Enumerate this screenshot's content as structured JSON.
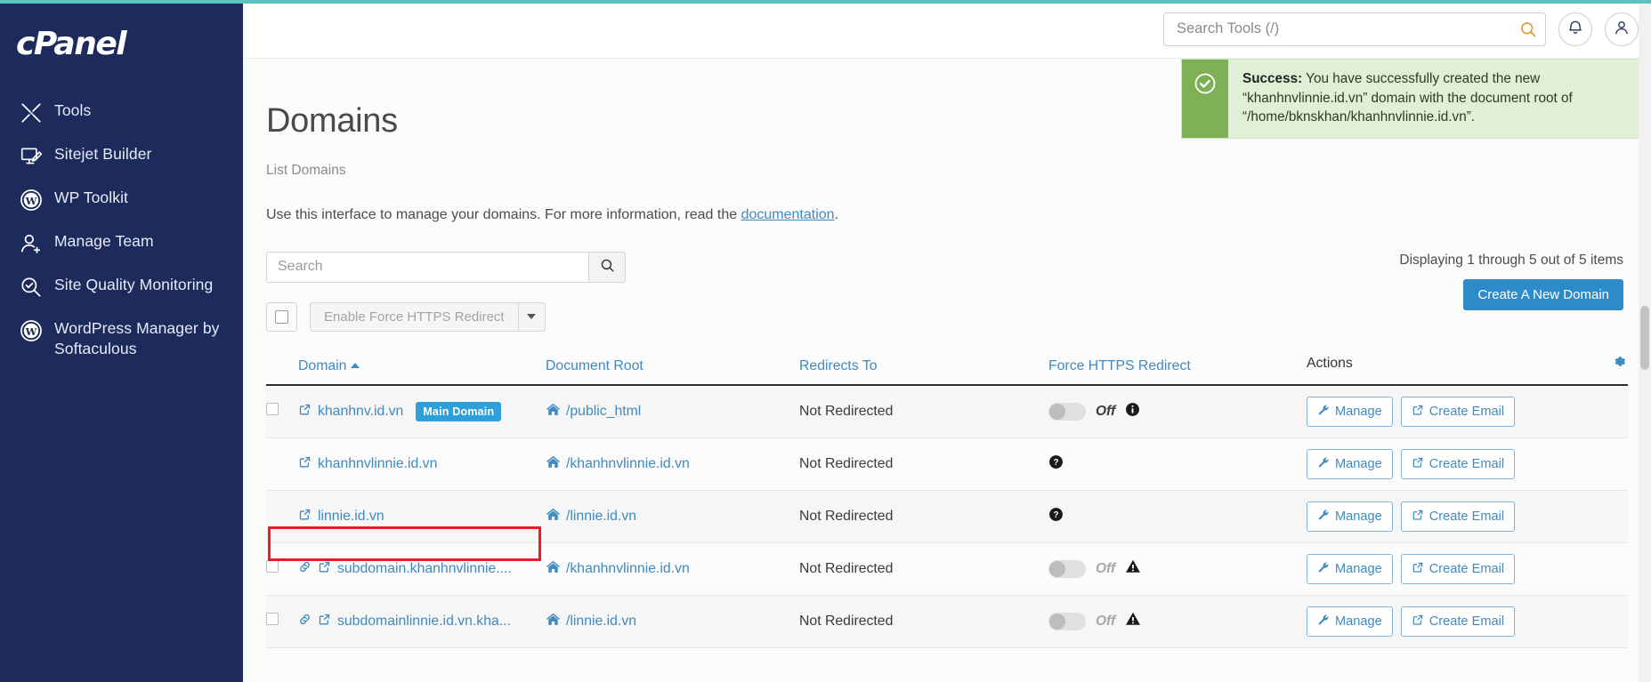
{
  "brand": {
    "logo_text": "cPanel"
  },
  "sidebar": {
    "items": [
      {
        "label": "Tools",
        "icon": "tools-icon"
      },
      {
        "label": "Sitejet Builder",
        "icon": "monitor-pencil-icon"
      },
      {
        "label": "WP Toolkit",
        "icon": "wordpress-icon"
      },
      {
        "label": "Manage Team",
        "icon": "user-add-icon"
      },
      {
        "label": "Site Quality Monitoring",
        "icon": "magnifier-check-icon"
      },
      {
        "label": "WordPress Manager by Softaculous",
        "icon": "wordpress-icon"
      }
    ]
  },
  "topbar": {
    "search_placeholder": "Search Tools (/)",
    "search_value": "",
    "search_icon": "search-icon",
    "notifications_icon": "bell-icon",
    "account_icon": "user-icon"
  },
  "alert": {
    "icon": "check-circle-icon",
    "label": "Success:",
    "message": " You have successfully created the new “khanhnvlinnie.id.vn” domain with the document root of “/home/bknskhan/khanhnvlinnie.id.vn”."
  },
  "page": {
    "title": "Domains",
    "subtitle": "List Domains",
    "description": "Use this interface to manage your domains. For more information, read the ",
    "doc_link": "documentation",
    "description_end": "."
  },
  "filter": {
    "search_placeholder": "Search",
    "search_value": "",
    "search_button_icon": "search-icon",
    "https_button_label": "Enable Force HTTPS Redirect",
    "caret_icon": "chevron-down-icon",
    "select_all_name": "select-all-checkbox"
  },
  "summary": {
    "displaying": "Displaying 1 through 5 out of 5 items",
    "create_button_label": "Create A New Domain"
  },
  "table": {
    "gear_icon": "gear-icon",
    "columns": [
      {
        "label": "Domain",
        "sorted": "asc"
      },
      {
        "label": "Document Root"
      },
      {
        "label": "Redirects To"
      },
      {
        "label": "Force HTTPS Redirect"
      },
      {
        "label": "Actions"
      }
    ],
    "actions": {
      "manage_label": "Manage",
      "manage_icon": "wrench-icon",
      "email_label": "Create Email",
      "email_icon": "external-link-icon"
    },
    "rows": [
      {
        "checkbox": true,
        "link_icon": false,
        "external_icon": "external-link-icon",
        "domain": "khanhnv.id.vn",
        "badge": "Main Domain",
        "root_icon": "home-icon",
        "root": "/public_html",
        "redirects_to": "Not Redirected",
        "https_state": "toggle",
        "https_label": "Off",
        "https_dim": false,
        "https_status_icon": "info-icon",
        "highlight": false
      },
      {
        "checkbox": false,
        "link_icon": false,
        "external_icon": "external-link-icon",
        "domain": "khanhnvlinnie.id.vn",
        "badge": "",
        "root_icon": "home-icon",
        "root": "/khanhnvlinnie.id.vn",
        "redirects_to": "Not Redirected",
        "https_state": "unknown",
        "https_label": "",
        "https_dim": false,
        "https_status_icon": "question-icon",
        "highlight": false
      },
      {
        "checkbox": false,
        "link_icon": false,
        "external_icon": "external-link-icon",
        "domain": "linnie.id.vn",
        "badge": "",
        "root_icon": "home-icon",
        "root": "/linnie.id.vn",
        "redirects_to": "Not Redirected",
        "https_state": "unknown",
        "https_label": "",
        "https_dim": false,
        "https_status_icon": "question-icon",
        "highlight": false
      },
      {
        "checkbox": true,
        "link_icon": "chain-link-icon",
        "external_icon": "external-link-icon",
        "domain": "subdomain.khanhnvlinnie....",
        "badge": "",
        "root_icon": "home-icon",
        "root": "/khanhnvlinnie.id.vn",
        "redirects_to": "Not Redirected",
        "https_state": "toggle",
        "https_label": "Off",
        "https_dim": true,
        "https_status_icon": "warning-icon",
        "highlight": true
      },
      {
        "checkbox": true,
        "link_icon": "chain-link-icon",
        "external_icon": "external-link-icon",
        "domain": "subdomainlinnie.id.vn.kha...",
        "badge": "",
        "root_icon": "home-icon",
        "root": "/linnie.id.vn",
        "redirects_to": "Not Redirected",
        "https_state": "toggle",
        "https_label": "Off",
        "https_dim": true,
        "https_status_icon": "warning-icon",
        "highlight": false
      }
    ]
  },
  "colors": {
    "sidebar_bg": "#1d2b5c",
    "accent_teal": "#5bc2c1",
    "link_blue": "#3f8abf",
    "primary_blue": "#2e8bc9",
    "success_green": "#7eb156",
    "highlight_red": "#ee1c22"
  }
}
